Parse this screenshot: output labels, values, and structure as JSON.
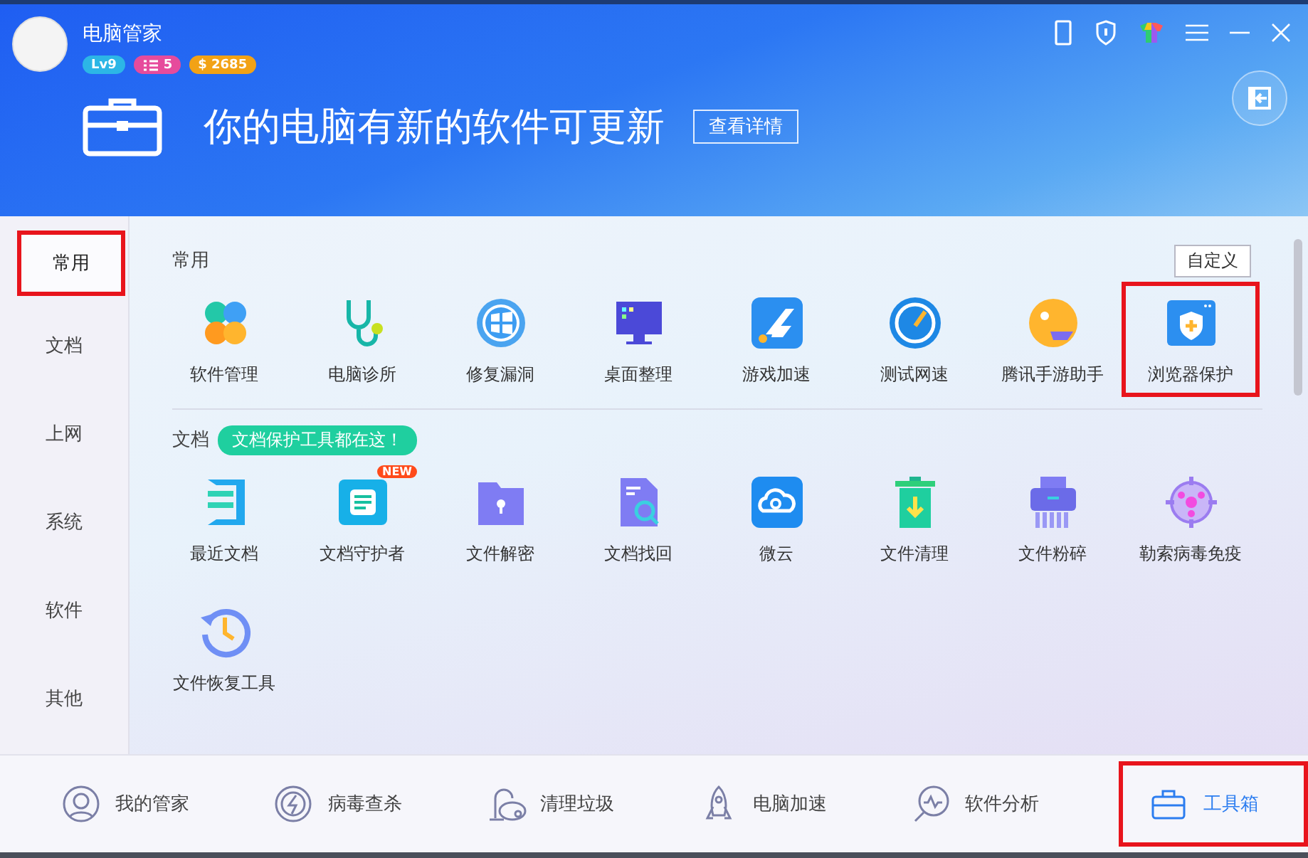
{
  "app": {
    "title": "电脑管家",
    "badges": [
      {
        "kind": "level",
        "text": "Lv9",
        "color": "#2cb6e6"
      },
      {
        "kind": "tasks",
        "text": "5",
        "color": "#e64b9c"
      },
      {
        "kind": "coins",
        "text": "$ 2685",
        "color": "#f2a215"
      }
    ]
  },
  "banner": {
    "message": "你的电脑有新的软件可更新",
    "button": "查看详情"
  },
  "sidebar": {
    "items": [
      {
        "label": "常用",
        "selected": true,
        "highlighted": true
      },
      {
        "label": "文档",
        "selected": false,
        "highlighted": false
      },
      {
        "label": "上网",
        "selected": false,
        "highlighted": false
      },
      {
        "label": "系统",
        "selected": false,
        "highlighted": false
      },
      {
        "label": "软件",
        "selected": false,
        "highlighted": false
      },
      {
        "label": "其他",
        "selected": false,
        "highlighted": false
      }
    ]
  },
  "customize_button": "自定义",
  "sections": [
    {
      "title": "常用",
      "items": [
        {
          "label": "软件管理",
          "kind": "clover",
          "highlighted": false
        },
        {
          "label": "电脑诊所",
          "kind": "stethoscope",
          "highlighted": false
        },
        {
          "label": "修复漏洞",
          "kind": "windows",
          "highlighted": false
        },
        {
          "label": "桌面整理",
          "kind": "monitor",
          "highlighted": false
        },
        {
          "label": "游戏加速",
          "kind": "game",
          "highlighted": false
        },
        {
          "label": "测试网速",
          "kind": "gauge",
          "highlighted": false
        },
        {
          "label": "腾讯手游助手",
          "kind": "mascot",
          "highlighted": false
        },
        {
          "label": "浏览器保护",
          "kind": "shield",
          "highlighted": true
        }
      ]
    },
    {
      "title": "文档",
      "tip": "文档保护工具都在这！",
      "items": [
        {
          "label": "最近文档",
          "kind": "layers",
          "highlighted": false
        },
        {
          "label": "文档守护者",
          "kind": "guard",
          "badge": "NEW",
          "highlighted": false
        },
        {
          "label": "文件解密",
          "kind": "folder",
          "highlighted": false
        },
        {
          "label": "文档找回",
          "kind": "search",
          "highlighted": false
        },
        {
          "label": "微云",
          "kind": "cloud",
          "highlighted": false
        },
        {
          "label": "文件清理",
          "kind": "trash",
          "highlighted": false
        },
        {
          "label": "文件粉碎",
          "kind": "shredder",
          "highlighted": false
        },
        {
          "label": "勒索病毒免疫",
          "kind": "virus",
          "highlighted": false
        },
        {
          "label": "文件恢复工具",
          "kind": "restore",
          "highlighted": false
        }
      ]
    }
  ],
  "bottom_nav": [
    {
      "label": "我的管家",
      "kind": "person",
      "highlighted": false
    },
    {
      "label": "病毒查杀",
      "kind": "bolt",
      "highlighted": false
    },
    {
      "label": "清理垃圾",
      "kind": "vacuum",
      "highlighted": false
    },
    {
      "label": "电脑加速",
      "kind": "rocket",
      "highlighted": false
    },
    {
      "label": "软件分析",
      "kind": "analysis",
      "highlighted": false
    },
    {
      "label": "工具箱",
      "kind": "toolbox",
      "highlighted": true
    }
  ]
}
